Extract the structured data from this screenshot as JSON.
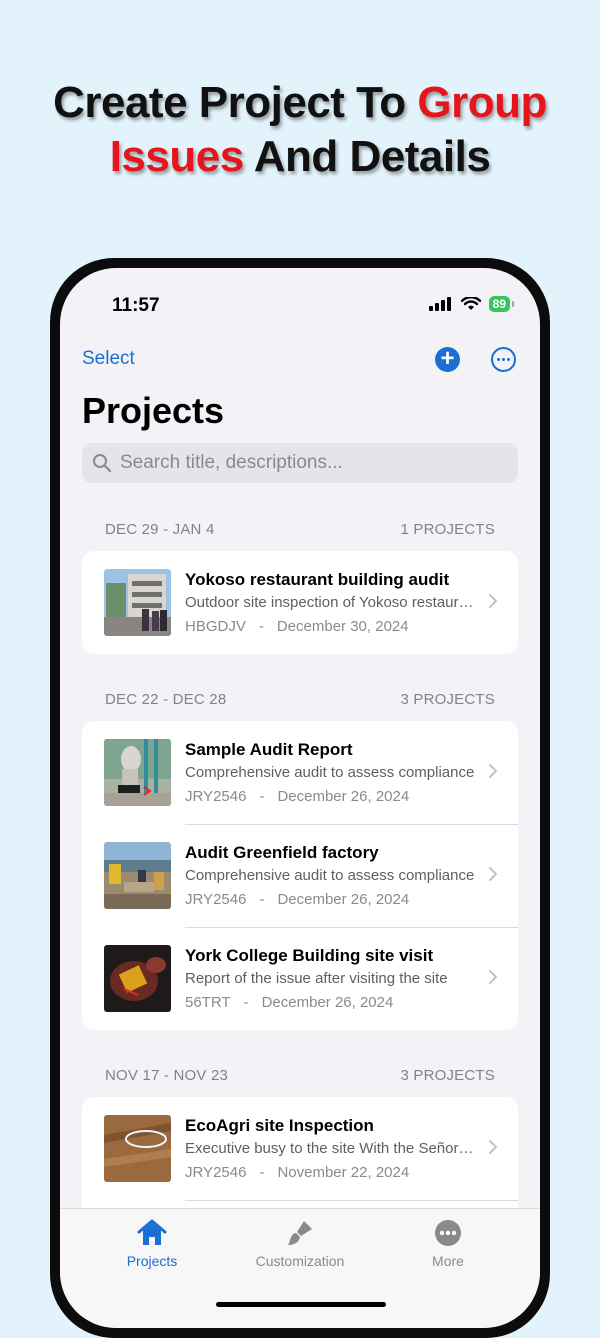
{
  "headline": {
    "line1_black": "Create Project To",
    "line1_red": "Group",
    "line2_red": "Issues",
    "line2_black": "And Details"
  },
  "status_bar": {
    "time": "11:57",
    "battery": "89"
  },
  "nav": {
    "select_label": "Select",
    "add_icon": "plus-circle-icon",
    "more_icon": "ellipsis-circle-icon"
  },
  "page": {
    "title": "Projects"
  },
  "search": {
    "placeholder": "Search title, descriptions..."
  },
  "groups": [
    {
      "range": "DEC 29 - JAN 4",
      "count": "1 PROJECTS",
      "items": [
        {
          "title": "Yokoso restaurant building audit",
          "description": "Outdoor site inspection of Yokoso restaurant building",
          "code": "HBGDJV",
          "date": "December 30, 2024"
        }
      ]
    },
    {
      "range": "DEC 22 - DEC 28",
      "count": "3 PROJECTS",
      "items": [
        {
          "title": "Sample Audit Report",
          "description": "Comprehensive audit to assess compliance",
          "code": "JRY2546",
          "date": "December 26, 2024"
        },
        {
          "title": "Audit Greenfield factory",
          "description": "Comprehensive audit to assess compliance",
          "code": "JRY2546",
          "date": "December 26, 2024"
        },
        {
          "title": "York College Building site visit",
          "description": "Report of the issue after visiting the site",
          "code": "56TRT",
          "date": "December 26, 2024"
        }
      ]
    },
    {
      "range": "NOV 17 - NOV 23",
      "count": "3 PROJECTS",
      "items": [
        {
          "title": "EcoAgri site Inspection",
          "description": "Executive busy to the site With the Señor team",
          "code": "JRY2546",
          "date": "November 22, 2024"
        }
      ]
    }
  ],
  "tabs": [
    {
      "label": "Projects",
      "icon": "house-icon",
      "active": true
    },
    {
      "label": "Customization",
      "icon": "paintbrush-icon",
      "active": false
    },
    {
      "label": "More",
      "icon": "ellipsis-circle-icon",
      "active": false
    }
  ],
  "colors": {
    "accent": "#1a6fd2",
    "headline_red": "#e8141b",
    "background": "#e3f3fb"
  }
}
